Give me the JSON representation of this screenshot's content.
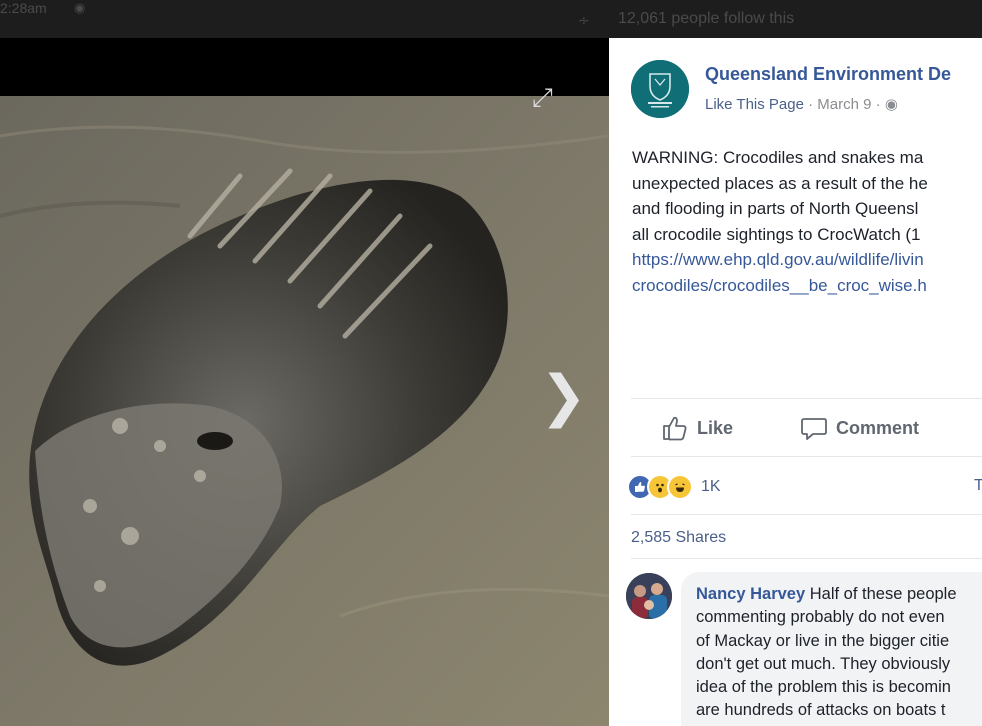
{
  "topbar": {
    "time": "2:28am",
    "globe_icon": "globe-icon",
    "rss_icon": "rss-icon",
    "followers": "12,061 people follow this"
  },
  "viewer": {
    "expand_icon": "expand-icon",
    "next_icon": "chevron-right-icon"
  },
  "post": {
    "page_name": "Queensland Environment De",
    "like_page": "Like This Page",
    "date": "March 9",
    "sep": "·",
    "lines": [
      "WARNING: Crocodiles and snakes ma",
      "unexpected places as a result of the he",
      "and flooding in parts of North Queensl",
      "all crocodile sightings to CrocWatch (1"
    ],
    "link_lines": [
      "https://www.ehp.qld.gov.au/wildlife/livin",
      "crocodiles/crocodiles__be_croc_wise.h"
    ]
  },
  "actions": {
    "like": "Like",
    "comment": "Comment"
  },
  "reactions": {
    "count": "1K",
    "truncated": "T",
    "shares": "2,585 Shares",
    "colors": {
      "like": "#4267b2",
      "emoji": "#f7c538"
    }
  },
  "comment": {
    "author": "Nancy Harvey",
    "first_line_rest": " Half of these people",
    "lines": [
      "commenting probably do not even",
      "of Mackay or live in the bigger citie",
      "don't get out much. They obviously",
      "idea of the problem this is becomin",
      "are hundreds of attacks on boats t"
    ]
  }
}
